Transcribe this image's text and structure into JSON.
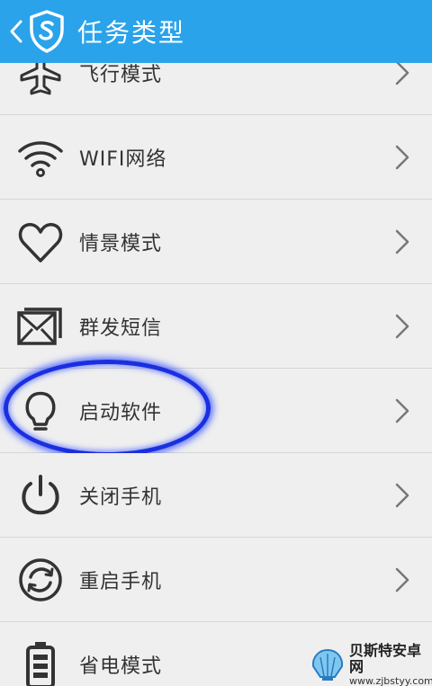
{
  "header": {
    "title": "任务类型",
    "background_color": "#2aa3ea"
  },
  "items": [
    {
      "label": "飞行模式",
      "icon": "airplane-icon"
    },
    {
      "label": "WIFI网络",
      "icon": "wifi-icon"
    },
    {
      "label": "情景模式",
      "icon": "heart-icon"
    },
    {
      "label": "群发短信",
      "icon": "message-icon"
    },
    {
      "label": "启动软件",
      "icon": "lightbulb-icon",
      "highlighted": true
    },
    {
      "label": "关闭手机",
      "icon": "power-icon"
    },
    {
      "label": "重启手机",
      "icon": "restart-icon"
    },
    {
      "label": "省电模式",
      "icon": "battery-icon"
    }
  ],
  "watermark": {
    "name": "贝斯特安卓网",
    "url": "www.zjbstyy.com"
  },
  "colors": {
    "row_bg": "#efefef",
    "separator": "#d6d6d6",
    "highlight": "#1a2fe0",
    "icon": "#333333"
  }
}
